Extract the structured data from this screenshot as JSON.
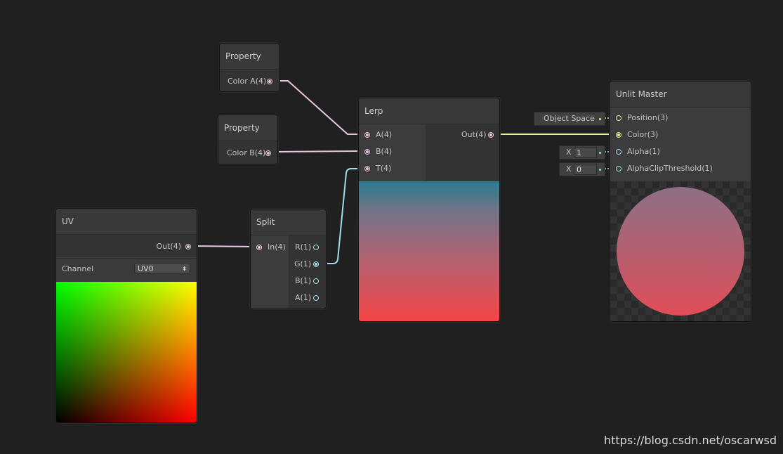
{
  "nodes": {
    "property_a": {
      "title": "Property",
      "output": "Color A(4)"
    },
    "property_b": {
      "title": "Property",
      "output": "Color B(4)"
    },
    "uv": {
      "title": "UV",
      "output": "Out(4)",
      "channel_label": "Channel",
      "channel_value": "UV0"
    },
    "split": {
      "title": "Split",
      "input": "In(4)",
      "outputs": [
        "R(1)",
        "G(1)",
        "B(1)",
        "A(1)"
      ]
    },
    "lerp": {
      "title": "Lerp",
      "inputs": [
        "A(4)",
        "B(4)",
        "T(4)"
      ],
      "output": "Out(4)"
    },
    "master": {
      "title": "Unlit Master",
      "inputs": [
        "Position(3)",
        "Color(3)",
        "Alpha(1)",
        "AlphaClipThreshold(1)"
      ],
      "position_space": "Object Space",
      "alpha_axis": "X",
      "alpha_value": "1",
      "clip_axis": "X",
      "clip_value": "0"
    }
  },
  "colors": {
    "vector4_port": "#e8c6e0",
    "vector1_port": "#9ee0ea",
    "vector3_port": "#ecef9a",
    "gradient_top": "#2a7c8e",
    "gradient_bottom": "#f44545"
  },
  "watermark": "https://blog.csdn.net/oscarwsd"
}
